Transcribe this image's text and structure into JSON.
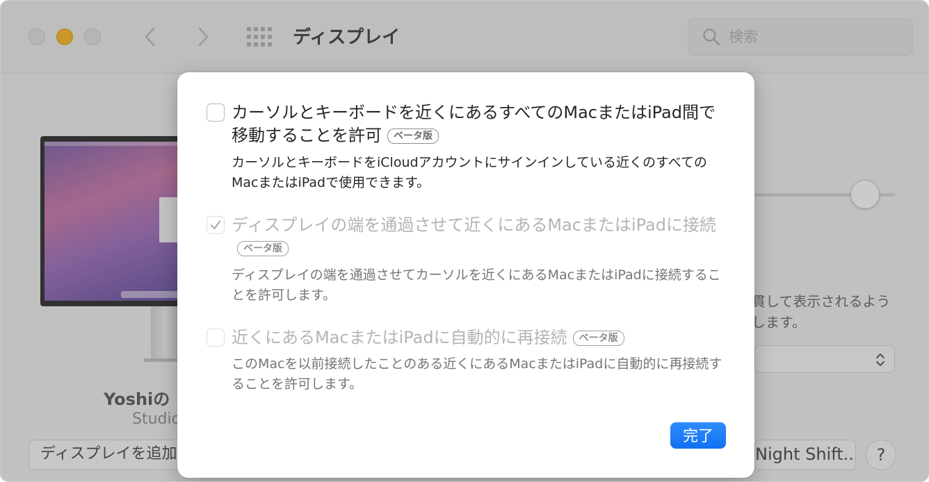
{
  "window": {
    "title": "ディスプレイ",
    "search_placeholder": "検索"
  },
  "background": {
    "device_name": "Yoshiの",
    "device_model": "Studio",
    "add_display_label": "ディスプレイを追加",
    "description": "貫して表示されるよう\nします。",
    "night_shift_label": "Night Shift...",
    "help_label": "?"
  },
  "sheet": {
    "options": [
      {
        "title": "カーソルとキーボードを近くにあるすべてのMacまたはiPad間で移動することを許可",
        "beta": "ベータ版",
        "description": "カーソルとキーボードをiCloudアカウントにサインインしている近くのすべてのMacまたはiPadで使用できます。",
        "checked": false,
        "enabled": true
      },
      {
        "title": "ディスプレイの端を通過させて近くにあるMacまたはiPadに接続",
        "beta": "ベータ版",
        "description": "ディスプレイの端を通過させてカーソルを近くにあるMacまたはiPadに接続することを許可します。",
        "checked": true,
        "enabled": false
      },
      {
        "title": "近くにあるMacまたはiPadに自動的に再接続",
        "beta": "ベータ版",
        "description": "このMacを以前接続したことのある近くにあるMacまたはiPadに自動的に再接続することを許可します。",
        "checked": false,
        "enabled": false
      }
    ],
    "done_label": "完了",
    "done_color": "#1a7cf6"
  }
}
